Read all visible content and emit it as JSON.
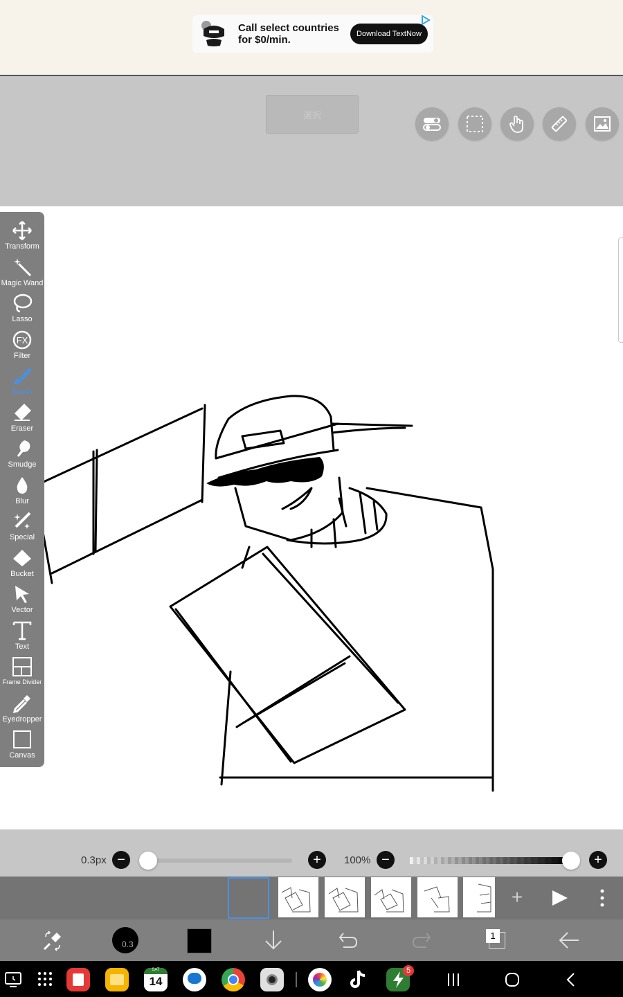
{
  "ad": {
    "headline_line1": "Call select countries",
    "headline_line2": "for $0/min.",
    "cta_label": "Download TextNow"
  },
  "top_bar": {
    "center_button_label": "選択",
    "icons": [
      "settings-toggle-icon",
      "selection-icon",
      "hand-icon",
      "ruler-icon",
      "image-icon"
    ]
  },
  "tools": [
    {
      "label": "Transform",
      "icon": "transform-icon"
    },
    {
      "label": "Magic Wand",
      "icon": "magic-wand-icon"
    },
    {
      "label": "Lasso",
      "icon": "lasso-icon"
    },
    {
      "label": "Filter",
      "icon": "fx-icon"
    },
    {
      "label": "Brush",
      "icon": "brush-icon",
      "active": true
    },
    {
      "label": "Eraser",
      "icon": "eraser-icon"
    },
    {
      "label": "Smudge",
      "icon": "smudge-icon"
    },
    {
      "label": "Blur",
      "icon": "blur-drop-icon"
    },
    {
      "label": "Special",
      "icon": "special-icon"
    },
    {
      "label": "Bucket",
      "icon": "bucket-icon"
    },
    {
      "label": "Vector",
      "icon": "vector-arrow-icon"
    },
    {
      "label": "Text",
      "icon": "text-icon"
    },
    {
      "label": "Frame Divider",
      "icon": "frame-divider-icon"
    },
    {
      "label": "Eyedropper",
      "icon": "eyedropper-icon"
    },
    {
      "label": "Canvas",
      "icon": "canvas-icon"
    }
  ],
  "brush_size": {
    "value_label": "0.3px",
    "slider_position": 0.0
  },
  "opacity": {
    "value_label": "100%",
    "slider_position": 1.0
  },
  "frames": {
    "count": 6,
    "selected_index": 0
  },
  "bottom_toolbar": {
    "brush_size_badge": "0.3",
    "color": "#000000",
    "layer_count": "1"
  },
  "status_bar": {
    "calendar_day": "14",
    "calendar_weekday": "SAT",
    "notification_badge": "5"
  },
  "colors": {
    "accent": "#4a90e2",
    "toolbar_bg": "#7f7f7f",
    "ui_bg": "#c6c6c6",
    "frames_bg": "#747474"
  }
}
